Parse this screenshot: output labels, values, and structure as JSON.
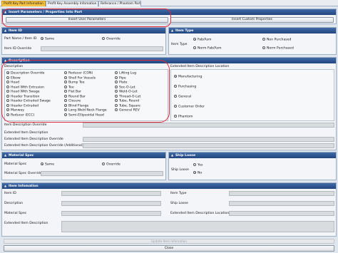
{
  "tabs": [
    {
      "label": "Profit Key Part Infomation",
      "active": true
    },
    {
      "label": "Profit Key Assembly Infomation",
      "active": false
    },
    {
      "label": "Referance / Phantom Part",
      "active": false
    }
  ],
  "insert_params": {
    "header": "Insert Parameters / Properties Into Part",
    "insert_user_button": "Insert User Parameters",
    "insert_custom_button": "Insert Custom Properties"
  },
  "item_id": {
    "header": "Item ID",
    "part_name_label": "Part Name / Item ID",
    "same_label": "Same",
    "override_label": "Override",
    "item_id_override_label": "Item ID Override"
  },
  "item_type": {
    "header": "Item Type",
    "label": "Item Type",
    "options": [
      "Fab/Asm",
      "Non Purchased",
      "Norm Fab/Asm",
      "Norm Purchased"
    ],
    "selected": "Fab/Asm"
  },
  "description": {
    "header": "Description",
    "group_label": "Description",
    "col1": [
      "Description Override",
      "Elbow",
      "Head",
      "Head With Extrusion",
      "Head With Swage",
      "Header Transition",
      "Header Extruded Swage",
      "Header Extruded",
      "Manway",
      "Reducer (ECC)"
    ],
    "col2": [
      "Reducer (CON)",
      "Shell For Vessels",
      "Bump Tee",
      "Tee",
      "Flat Bar",
      "Round Bar",
      "Closure",
      "Blind Flange",
      "Long Weld Neck Flange",
      "Semi-Ellipsoidal Head"
    ],
    "col3": [
      "Lifting Lug",
      "Pipe",
      "Plate",
      "Soc-O-Let",
      "Weld-O-Let",
      "Thread-O-Let",
      "Tube, Round",
      "Tube, Square",
      "General REV"
    ],
    "selected": "Description Override"
  },
  "ext_location": {
    "header": "Extended Item Description Location",
    "options": [
      "Manufacturing",
      "Purchasing",
      "General",
      "Customer Order",
      "Phantom"
    ],
    "selected": "Manufacturing"
  },
  "overrides": {
    "item_desc_override": "Item Description Override",
    "ext_desc": "Extended Item Description",
    "ext_desc_override": "Extended Item Description Override",
    "ext_desc_override_add": "Extended Item Description Override (Additional)"
  },
  "material_spec": {
    "header": "Material Spec",
    "label": "Material Spec",
    "same_label": "Same",
    "override_label": "Override",
    "override_field_label": "Material Spec Override"
  },
  "ship_loose": {
    "header": "Ship Loose",
    "label": "Ship Loose",
    "yes": "Yes",
    "no": "No",
    "selected": "No"
  },
  "item_info": {
    "header": "Item Infomation",
    "item_id": "Item ID",
    "description": "Description",
    "material_spec": "Material Spec",
    "ext_desc": "Extended Item Description",
    "item_type": "Item Type",
    "ship_loose": "Ship Loose",
    "ext_desc_location": "Extended Item Description Location"
  },
  "footer": {
    "update_button": "Update Item Infomation",
    "close_button": "Close"
  }
}
